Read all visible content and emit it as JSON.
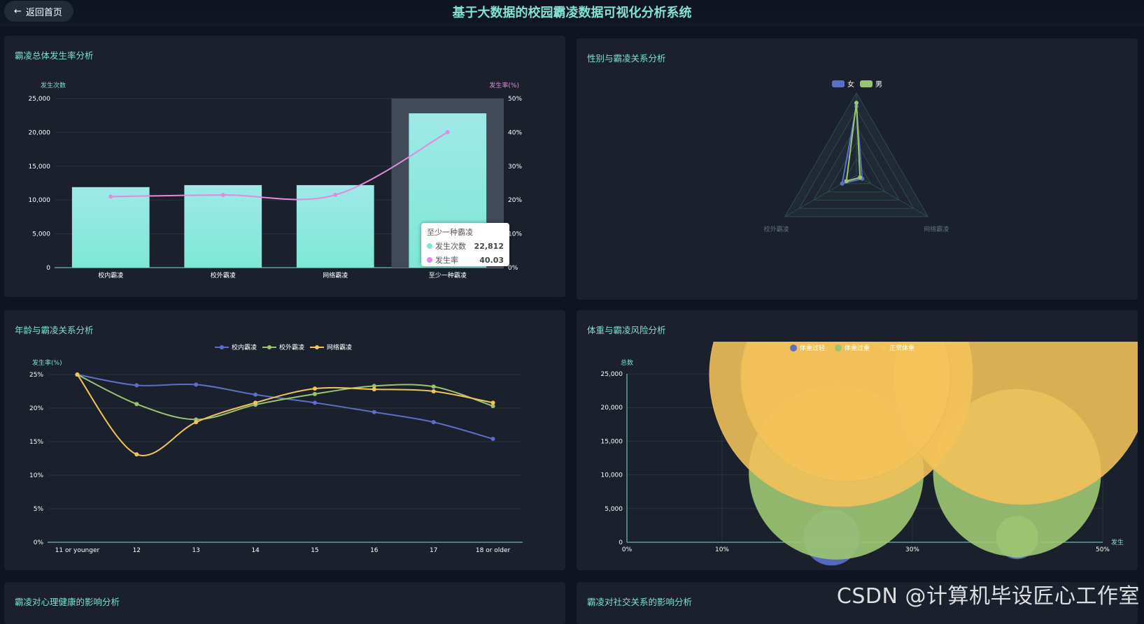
{
  "header": {
    "back_label": "返回首页",
    "title": "基于大数据的校园霸凌数据可视化分析系统"
  },
  "panels": {
    "p1_title": "霸凌总体发生率分析",
    "p2_title": "性别与霸凌关系分析",
    "p3_title": "年龄与霸凌关系分析",
    "p4_title": "体重与霸凌风险分析",
    "p5_title": "霸凌对心理健康的影响分析",
    "p6_title": "霸凌对社交关系的影响分析"
  },
  "colors": {
    "teal": "#7ee8d6",
    "pink": "#e589e0",
    "blue": "#5b6fc8",
    "green": "#9bc472",
    "orange": "#f4c35a"
  },
  "chart_data": [
    {
      "type": "bar",
      "categories": [
        "校内霸凌",
        "校外霸凌",
        "网络霸凌",
        "至少一种霸凌"
      ],
      "series": [
        {
          "name": "发生次数",
          "values": [
            11900,
            12200,
            12200,
            22812
          ]
        },
        {
          "name": "发生率",
          "values": [
            21,
            21.5,
            21.5,
            40.03
          ]
        }
      ],
      "ylabel": "发生次数",
      "y2label": "发生率(%)",
      "ylim": [
        0,
        25000
      ],
      "y2lim": [
        0,
        50
      ],
      "yticks": [
        "0",
        "5,000",
        "10,000",
        "15,000",
        "20,000",
        "25,000"
      ],
      "y2ticks": [
        "0%",
        "10%",
        "20%",
        "30%",
        "40%",
        "50%"
      ],
      "tooltip": {
        "title": "至少一种霸凌",
        "rows": [
          {
            "label": "发生次数",
            "value": "22,812"
          },
          {
            "label": "发生率",
            "value": "40.03"
          }
        ]
      }
    },
    {
      "type": "radar",
      "legend": [
        "女",
        "男"
      ],
      "indicators": [
        "",
        "校外霸凌",
        "网络霸凌"
      ],
      "series": [
        {
          "name": "女",
          "values": [
            0.84,
            0.2,
            0.08
          ]
        },
        {
          "name": "男",
          "values": [
            0.88,
            0.14,
            0.05
          ]
        }
      ]
    },
    {
      "type": "line",
      "x": [
        "11 or younger",
        "12",
        "13",
        "14",
        "15",
        "16",
        "17",
        "18 or older"
      ],
      "ylabel": "发生率(%)",
      "ylim": [
        0,
        25
      ],
      "yticks": [
        "0%",
        "5%",
        "10%",
        "15%",
        "20%",
        "25%"
      ],
      "series": [
        {
          "name": "校内霸凌",
          "values": [
            25,
            23.4,
            23.5,
            22,
            20.8,
            19.4,
            17.9,
            15.4
          ]
        },
        {
          "name": "校外霸凌",
          "values": [
            25,
            20.6,
            18.3,
            20.5,
            22.1,
            23.3,
            23.2,
            20.3
          ]
        },
        {
          "name": "网络霸凌",
          "values": [
            25,
            13.1,
            17.9,
            20.8,
            22.9,
            22.8,
            22.5,
            20.8
          ]
        }
      ]
    },
    {
      "type": "scatter",
      "legend": [
        "体重过轻",
        "体重过重",
        "正常体重"
      ],
      "ylabel": "总数",
      "xlabel": "发生",
      "ylim": [
        0,
        25000
      ],
      "xlim": [
        0,
        50
      ],
      "yticks": [
        "0",
        "5,000",
        "10,000",
        "15,000",
        "20,000",
        "25,000"
      ],
      "xticks": [
        "0%",
        "10%",
        "30%",
        "50%"
      ],
      "series": [
        {
          "name": "体重过轻",
          "points": [
            [
              21.5,
              700
            ],
            [
              41,
              600
            ]
          ]
        },
        {
          "name": "体重过重",
          "points": [
            [
              22,
              10400
            ],
            [
              41,
              10300
            ],
            [
              41,
              800
            ]
          ]
        },
        {
          "name": "正常体重",
          "points": [
            [
              22.5,
              24800
            ],
            [
              41.5,
              24600
            ],
            [
              23,
              24600
            ]
          ]
        }
      ]
    }
  ],
  "watermark": "CSDN @计算机毕设匠心工作室"
}
